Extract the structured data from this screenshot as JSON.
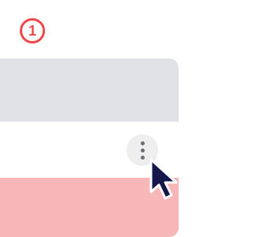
{
  "step": {
    "number": "1",
    "color": "#f04747"
  },
  "card": {
    "rows": [
      {
        "name": "header-row",
        "color": "#dfe1e6"
      },
      {
        "name": "selected-row",
        "color": "#ffffff"
      },
      {
        "name": "highlighted-row",
        "color": "#f7b7b9"
      }
    ]
  },
  "more_button": {
    "icon": "more-vertical-icon",
    "background": "#eeeeee",
    "dot_color": "#6b6f76"
  },
  "cursor": {
    "icon": "mouse-pointer-icon",
    "fill": "#15174a",
    "stroke": "#ffffff"
  }
}
